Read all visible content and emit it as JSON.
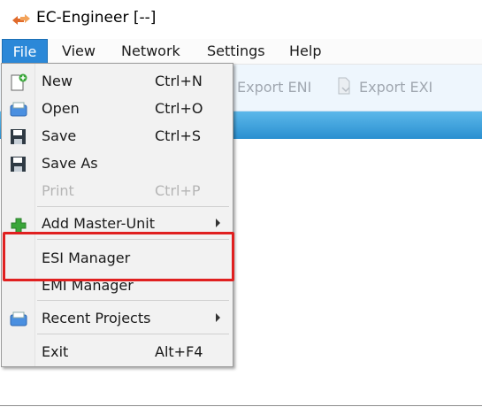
{
  "window": {
    "title": "EC-Engineer [--]",
    "app_icon": "ec-engineer-logo-icon"
  },
  "menubar": {
    "items": [
      "File",
      "View",
      "Network",
      "Settings",
      "Help"
    ],
    "active": "File"
  },
  "toolbar": {
    "export_eni": "Export ENI",
    "export_exi": "Export EXI"
  },
  "file_menu": {
    "items": [
      {
        "label": "New",
        "shortcut": "Ctrl+N",
        "icon": "new-file-icon"
      },
      {
        "label": "Open",
        "shortcut": "Ctrl+O",
        "icon": "open-icon"
      },
      {
        "label": "Save",
        "shortcut": "Ctrl+S",
        "icon": "save-icon"
      },
      {
        "label": "Save As",
        "shortcut": "",
        "icon": "save-as-icon"
      },
      {
        "label": "Print",
        "shortcut": "Ctrl+P",
        "disabled": true
      },
      {
        "label": "Add Master-Unit",
        "submenu": true,
        "icon": "add-icon"
      },
      {
        "label": "ESI Manager",
        "highlighted": true
      },
      {
        "label": "EMI Manager"
      },
      {
        "label": "Recent Projects",
        "submenu": true,
        "icon": "recent-projects-icon"
      },
      {
        "label": "Exit",
        "shortcut": "Alt+F4"
      }
    ]
  },
  "colors": {
    "menu_active_bg": "#2b88d8",
    "toolbar_bg": "#eef6fd",
    "toolbar_disabled_text": "#a0a7b0",
    "strip_blue": "#2a8fd0",
    "highlight_red": "#e02020"
  }
}
